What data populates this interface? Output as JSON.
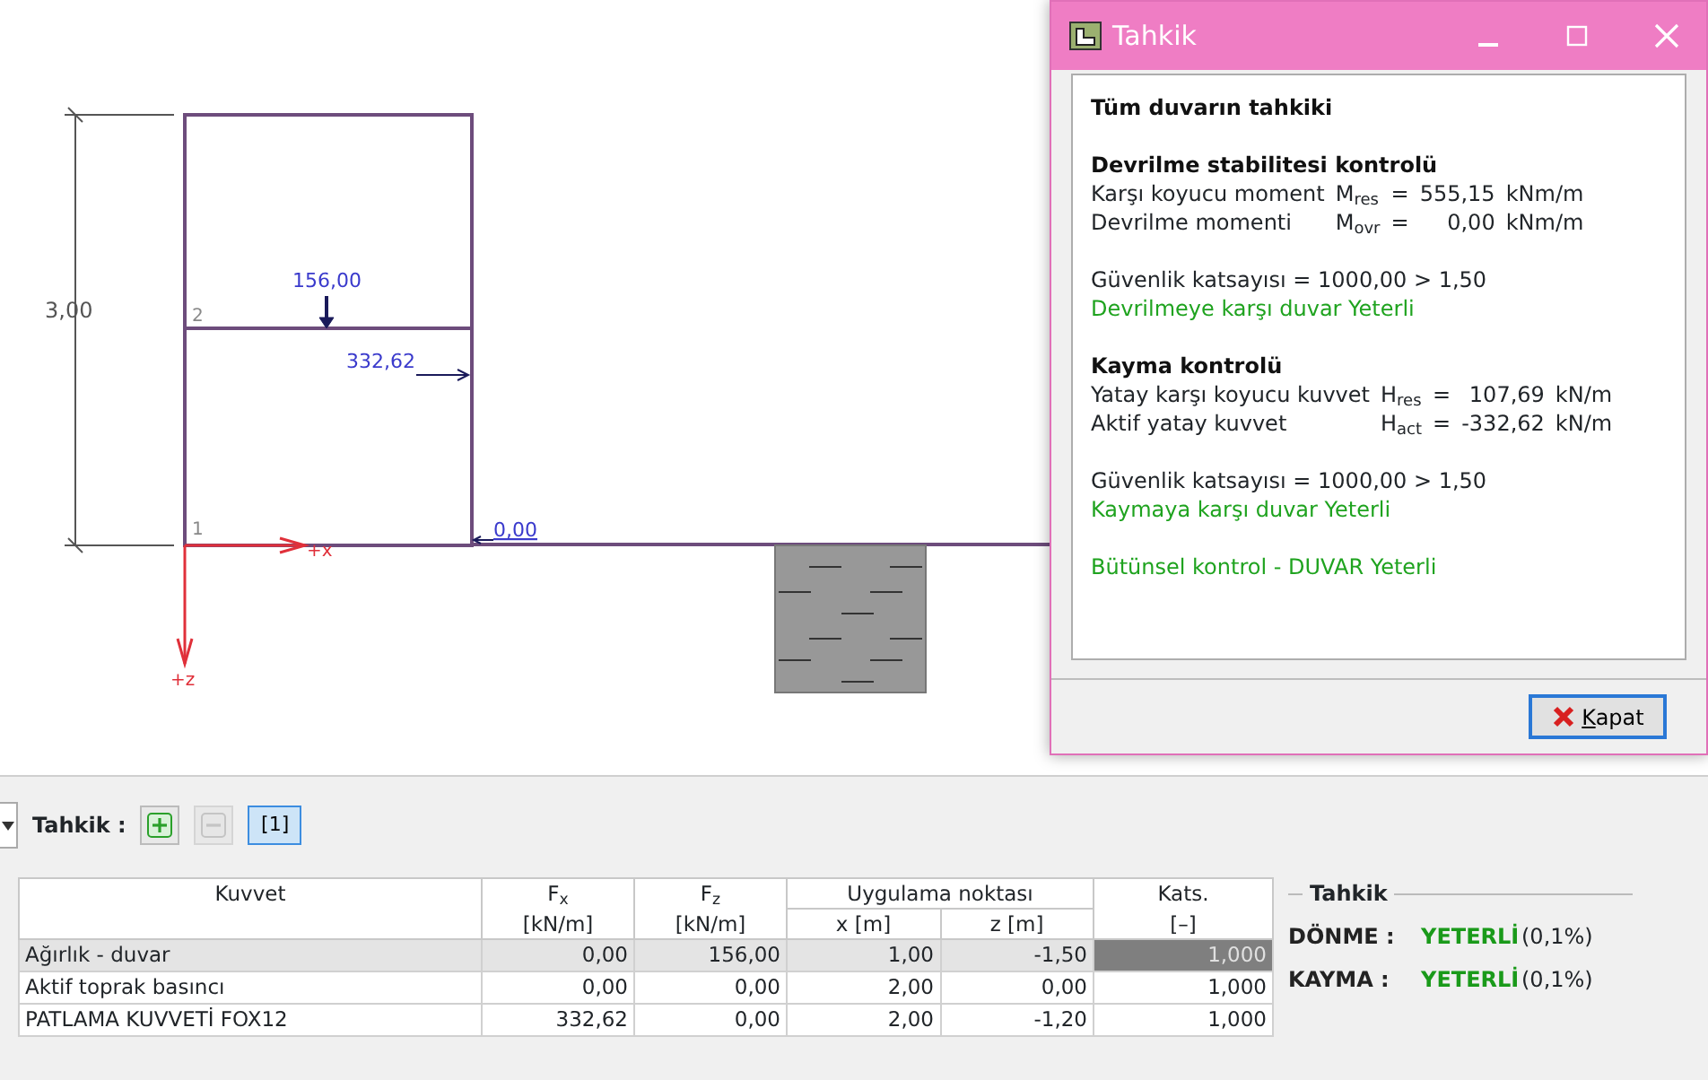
{
  "canvas": {
    "dimension": "3,00",
    "node_labels": [
      "2",
      "1"
    ],
    "loads": [
      {
        "kind": "vertical",
        "value": "156,00"
      },
      {
        "kind": "horizontal",
        "value": "332,62"
      },
      {
        "kind": "base",
        "value": "0,00"
      }
    ],
    "axes": [
      "+x",
      "+z"
    ]
  },
  "dialog": {
    "title": "Tahkik",
    "close_button": "Kapat",
    "groups": [
      [
        {
          "kind": "title",
          "text": "Tüm duvarın tahkiki"
        }
      ],
      [
        {
          "kind": "heading",
          "text": "Devrilme stabilitesi kontrolü"
        },
        {
          "kind": "row",
          "label": "Karşı koyucu moment",
          "symbol": "M$_{res}$",
          "sign": "=",
          "value": "555,15",
          "unit": "kNm/m"
        },
        {
          "kind": "row",
          "label": "Devrilme momenti",
          "symbol": "M$_{ovr}$",
          "sign": "=",
          "value": "0,00",
          "unit": "kNm/m"
        }
      ],
      [
        {
          "kind": "text",
          "text": "Güvenlik katsayısı = 1000,00 > 1,50"
        },
        {
          "kind": "ok",
          "text": "Devrilmeye karşı duvar Yeterli"
        }
      ],
      [
        {
          "kind": "heading",
          "text": "Kayma kontrolü"
        },
        {
          "kind": "row",
          "label": "Yatay karşı koyucu kuvvet",
          "symbol": "H$_{res}$",
          "sign": "=",
          "value": "107,69",
          "unit": "kN/m"
        },
        {
          "kind": "row",
          "label": "Aktif yatay kuvvet",
          "symbol": "H$_{act}$",
          "sign": "=",
          "value": "-332,62",
          "unit": "kN/m"
        }
      ],
      [
        {
          "kind": "text",
          "text": "Güvenlik katsayısı = 1000,00 > 1,50"
        },
        {
          "kind": "ok",
          "text": "Kaymaya karşı duvar Yeterli"
        }
      ],
      [
        {
          "kind": "ok",
          "text": "Bütünsel kontrol - DUVAR Yeterli"
        }
      ]
    ]
  },
  "toolbar": {
    "label": "Tahkik :",
    "items": [
      {
        "kind": "add",
        "disabled": false
      },
      {
        "kind": "remove",
        "disabled": true
      },
      {
        "kind": "index",
        "text": "[1]",
        "selected": true
      }
    ]
  },
  "table": {
    "columns": [
      {
        "title": "Kuvvet"
      },
      {
        "title": "F$_{x}$"
      },
      {
        "title": "F$_{z}$"
      },
      {
        "title": "Uygulama noktası",
        "colspan": 2
      },
      {
        "title": "Kats."
      }
    ],
    "unit_row": [
      "[kN/m]",
      "[kN/m]",
      "x [m]",
      "z [m]",
      "[–]"
    ],
    "rows": [
      {
        "selected": true,
        "cells": [
          "Ağırlık - duvar",
          "0,00",
          "156,00",
          "1,00",
          "-1,50",
          "1,000"
        ]
      },
      {
        "selected": false,
        "cells": [
          "Aktif toprak basıncı",
          "0,00",
          "0,00",
          "2,00",
          "0,00",
          "1,000"
        ]
      },
      {
        "selected": false,
        "cells": [
          "PATLAMA KUVVETİ FOX12",
          "332,62",
          "0,00",
          "2,00",
          "-1,20",
          "1,000"
        ]
      }
    ]
  },
  "summary": {
    "title": "Tahkik",
    "rows": [
      {
        "label": "DÖNME :",
        "status": "YETERLİ",
        "percent": "(0,1%)"
      },
      {
        "label": "KAYMA :",
        "status": "YETERLİ",
        "percent": "(0,1%)"
      }
    ]
  }
}
